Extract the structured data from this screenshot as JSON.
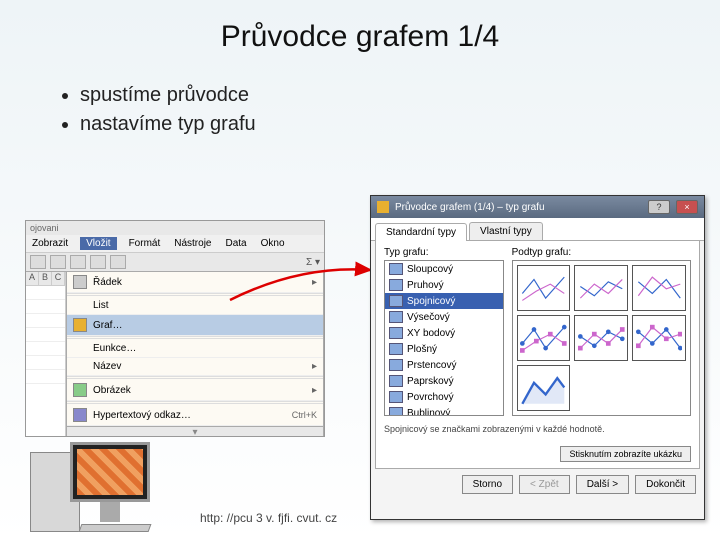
{
  "title": "Průvodce grafem 1/4",
  "bullets": [
    "spustíme průvodce",
    "nastavíme typ grafu"
  ],
  "footer_url": "http: //pcu 3 v. fjfi. cvut. cz",
  "left_shot": {
    "top_label": "ojovani",
    "menubar": [
      "Zobrazit",
      "Vložit",
      "Formát",
      "Nástroje",
      "Data",
      "Okno"
    ],
    "active_menu_index": 1,
    "col_headers": [
      "A",
      "B",
      "C"
    ],
    "menu_items": [
      {
        "label": "Řádek",
        "icon": true,
        "arrow": true
      },
      {
        "label": "List",
        "icon": false
      },
      {
        "label": "Graf…",
        "icon": true,
        "highlight": true
      },
      {
        "label": "Eunkce…",
        "icon": false
      },
      {
        "label": "Název",
        "icon": false,
        "arrow": true
      },
      {
        "label": "Obrázek",
        "icon": true,
        "arrow": true
      },
      {
        "label": "Hypertextový odkaz…",
        "icon": true,
        "shortcut": "Ctrl+K"
      }
    ]
  },
  "dialog": {
    "titlebar": "Průvodce grafem (1/4) – typ grafu",
    "help_glyph": "?",
    "close_glyph": "×",
    "tabs": [
      "Standardní typy",
      "Vlastní typy"
    ],
    "active_tab_index": 0,
    "left_label": "Typ grafu:",
    "right_label": "Podtyp grafu:",
    "chart_types": [
      "Sloupcový",
      "Pruhový",
      "Spojnicový",
      "Výsečový",
      "XY bodový",
      "Plošný",
      "Prstencový",
      "Paprskový",
      "Povrchový",
      "Bublinový"
    ],
    "selected_type_index": 2,
    "description": "Spojnicový se značkami zobrazenými v každé hodnotě.",
    "preview_button": "Stisknutím zobrazíte ukázku",
    "buttons": {
      "cancel": "Storno",
      "back": "< Zpět",
      "next": "Další >",
      "finish": "Dokončit"
    }
  }
}
